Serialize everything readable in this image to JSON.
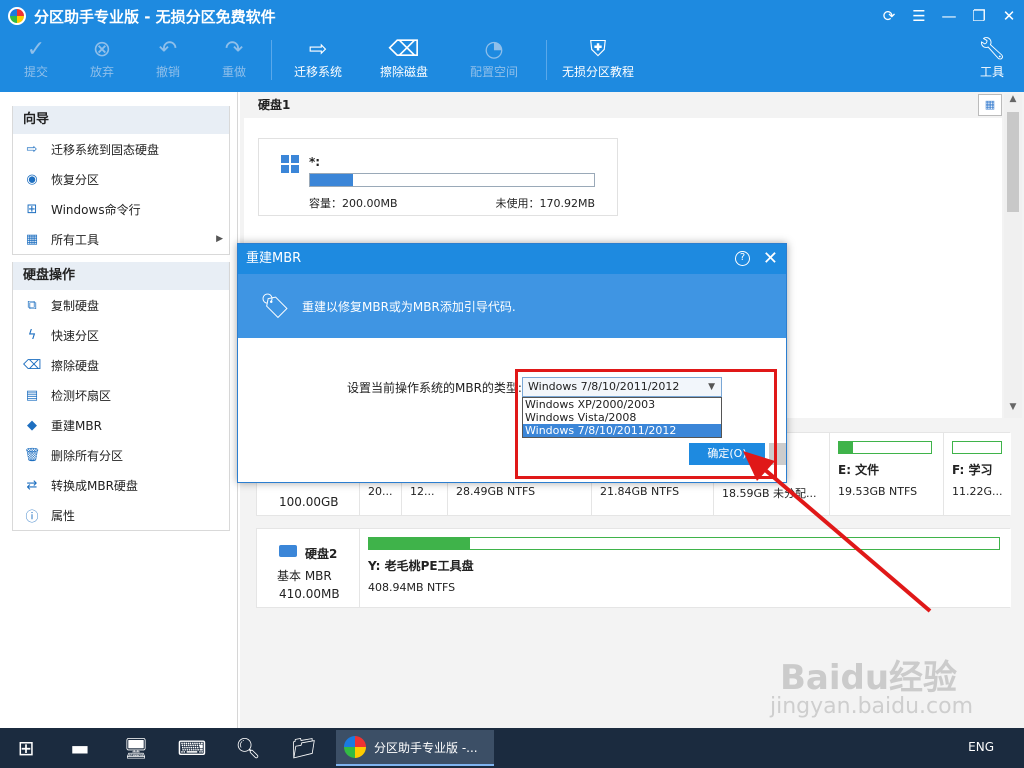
{
  "app": {
    "title": "分区助手专业版 - 无损分区免费软件"
  },
  "window_controls": {
    "refresh": "⟳",
    "menu": "☰",
    "minimize": "—",
    "maximize": "❐",
    "close": "✕"
  },
  "toolbar": {
    "submit": "提交",
    "discard": "放弃",
    "undo": "撤销",
    "redo": "重做",
    "migrate": "迁移系统",
    "wipe": "擦除磁盘",
    "config": "配置空间",
    "tutorial": "无损分区教程",
    "tools": "工具"
  },
  "sidebar": {
    "wizard_title": "向导",
    "wizard_items": [
      {
        "label": "迁移系统到固态硬盘"
      },
      {
        "label": "恢复分区"
      },
      {
        "label": "Windows命令行"
      },
      {
        "label": "所有工具"
      }
    ],
    "disk_ops_title": "硬盘操作",
    "disk_ops_items": [
      {
        "label": "复制硬盘"
      },
      {
        "label": "快速分区"
      },
      {
        "label": "擦除硬盘"
      },
      {
        "label": "检测坏扇区"
      },
      {
        "label": "重建MBR"
      },
      {
        "label": "删除所有分区"
      },
      {
        "label": "转换成MBR硬盘"
      },
      {
        "label": "属性"
      }
    ]
  },
  "disk1": {
    "label": "硬盘1",
    "partition": {
      "name": "*:",
      "capacity": "容量：200.00MB",
      "free": "未使用：170.92MB",
      "used_fraction": 0.15
    },
    "size": "100.00GB",
    "segments": [
      {
        "name": "",
        "fs": "20..."
      },
      {
        "name": "",
        "fs": "12..."
      },
      {
        "name": "",
        "fs": "28.49GB NTFS"
      },
      {
        "name": "",
        "fs": "21.84GB NTFS"
      },
      {
        "name": "",
        "fs": "18.59GB 未分配..."
      },
      {
        "name": "E: 文件",
        "fs": "19.53GB NTFS",
        "used_fraction": 0.15
      },
      {
        "name": "F: 学习",
        "fs": "11.22G...",
        "used_fraction": 0.0
      }
    ]
  },
  "disk2": {
    "label": "硬盘2",
    "type": "基本 MBR",
    "size": "410.00MB",
    "partition": {
      "name": "Y: 老毛桃PE工具盘",
      "fs": "408.94MB NTFS",
      "used_fraction": 0.16
    }
  },
  "dialog": {
    "title": "重建MBR",
    "message": "重建以修复MBR或为MBR添加引导代码.",
    "label": "设置当前操作系统的MBR的类型:",
    "selected": "Windows 7/8/10/2011/2012",
    "options": [
      "Windows XP/2000/2003",
      "Windows Vista/2008",
      "Windows 7/8/10/2011/2012"
    ],
    "ok": "确定(O)"
  },
  "taskbar": {
    "active_task": "分区助手专业版 -...",
    "tray_lang": "ENG"
  },
  "watermark": {
    "brand": "Baidu经验",
    "url": "jingyan.baidu.com"
  },
  "colors": {
    "accent": "#1e8ae0",
    "highlight": "#e01818",
    "used": "#3fb34a"
  }
}
